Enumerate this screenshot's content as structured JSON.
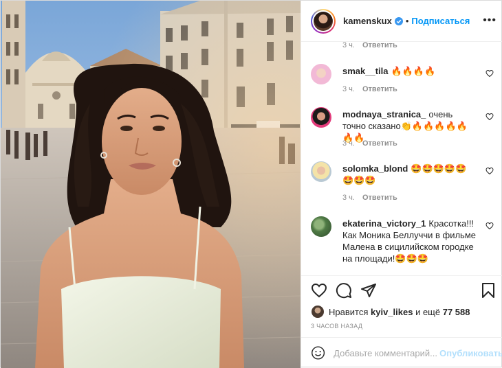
{
  "header": {
    "username": "kamenskux",
    "separator": "•",
    "follow_label": "Подписаться",
    "more_label": "•••"
  },
  "comments": {
    "top_meta": {
      "time": "3 ч.",
      "reply": "Ответить"
    },
    "items": [
      {
        "user": "smak__tila",
        "text": "🔥🔥🔥🔥",
        "time": "3 ч.",
        "reply": "Ответить"
      },
      {
        "user": "modnaya_stranica_",
        "text": "очень точно сказано👏🔥🔥🔥🔥🔥🔥🔥",
        "time": "3 ч.",
        "reply": "Ответить"
      },
      {
        "user": "solomka_blond",
        "text": "🤩🤩🤩🤩🤩🤩🤩🤩",
        "time": "3 ч.",
        "reply": "Ответить"
      },
      {
        "user": "ekaterina_victory_1",
        "text": "Красотка!!! Как Моника Беллуччи в фильме Малена в сицилийском городке на площади!🤩🤩🤩",
        "time": "",
        "reply": ""
      }
    ]
  },
  "likes": {
    "prefix": "Нравится",
    "liker": "kyiv_likes",
    "middle": "и ещё",
    "count": "77 588"
  },
  "timestamp": "3 ЧАСОВ НАЗАД",
  "add_comment": {
    "placeholder": "Добавьте комментарий...",
    "publish_label": "Опубликовать"
  },
  "icons": {
    "verified": "verified-badge-icon",
    "like": "heart-icon",
    "comment": "comment-icon",
    "share": "paper-plane-icon",
    "save": "bookmark-icon",
    "emoji": "smiley-icon"
  },
  "colors": {
    "accent": "#0095f6",
    "publish_disabled": "#b2dffc",
    "muted": "#8e8e8e"
  }
}
